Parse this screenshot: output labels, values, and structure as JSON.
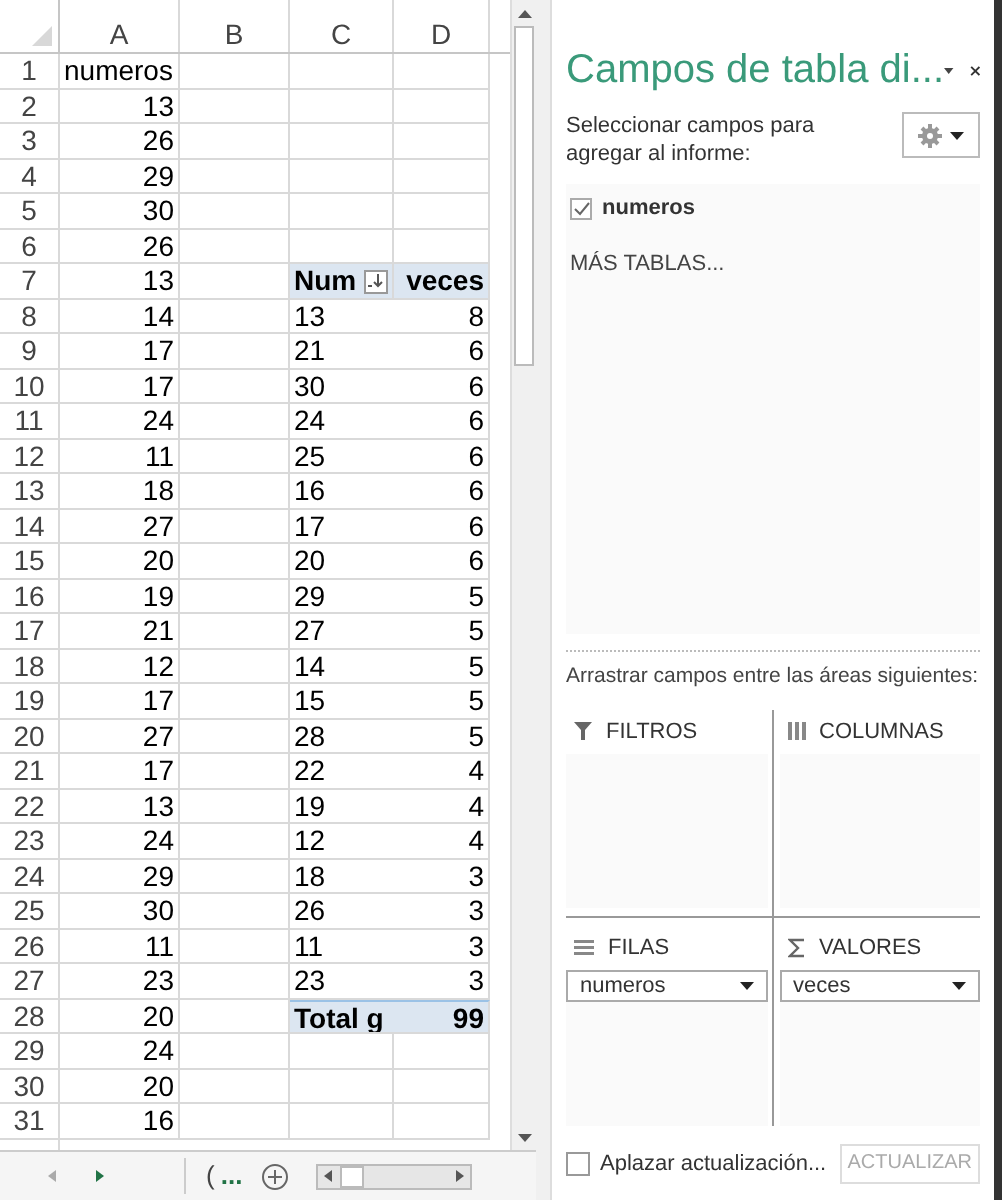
{
  "sheet": {
    "columns": [
      "A",
      "B",
      "C",
      "D"
    ],
    "row_numbers": [
      "1",
      "2",
      "3",
      "4",
      "5",
      "6",
      "7",
      "8",
      "9",
      "10",
      "11",
      "12",
      "13",
      "14",
      "15",
      "16",
      "17",
      "18",
      "19",
      "20",
      "21",
      "22",
      "23",
      "24",
      "25",
      "26",
      "27",
      "28",
      "29",
      "30",
      "31"
    ],
    "column_a": {
      "header": "numeros",
      "values": [
        "13",
        "26",
        "29",
        "30",
        "26",
        "13",
        "14",
        "17",
        "17",
        "24",
        "11",
        "18",
        "27",
        "20",
        "19",
        "21",
        "12",
        "17",
        "27",
        "17",
        "13",
        "24",
        "29",
        "30",
        "11",
        "23",
        "20",
        "24",
        "20",
        "16"
      ]
    },
    "pivot": {
      "header": [
        "Num",
        "veces"
      ],
      "rows": [
        [
          "13",
          "8"
        ],
        [
          "21",
          "6"
        ],
        [
          "30",
          "6"
        ],
        [
          "24",
          "6"
        ],
        [
          "25",
          "6"
        ],
        [
          "16",
          "6"
        ],
        [
          "17",
          "6"
        ],
        [
          "20",
          "6"
        ],
        [
          "29",
          "5"
        ],
        [
          "27",
          "5"
        ],
        [
          "14",
          "5"
        ],
        [
          "15",
          "5"
        ],
        [
          "28",
          "5"
        ],
        [
          "22",
          "4"
        ],
        [
          "19",
          "4"
        ],
        [
          "12",
          "4"
        ],
        [
          "18",
          "3"
        ],
        [
          "26",
          "3"
        ],
        [
          "11",
          "3"
        ],
        [
          "23",
          "3"
        ]
      ],
      "total": [
        "Total g",
        "99"
      ]
    }
  },
  "tab_bar": {
    "sheet_tab": "(",
    "more": "..."
  },
  "panel": {
    "title": "Campos de tabla di...",
    "subtitle": "Seleccionar campos para agregar al informe:",
    "fields": [
      {
        "label": "numeros",
        "checked": true
      }
    ],
    "more_tables": "MÁS TABLAS...",
    "drag_hint": "Arrastrar campos entre las áreas siguientes:",
    "areas": [
      {
        "kind": "filters",
        "label": "FILTROS"
      },
      {
        "kind": "columns",
        "label": "COLUMNAS"
      },
      {
        "kind": "rows",
        "label": "FILAS",
        "fields": [
          "numeros"
        ]
      },
      {
        "kind": "values",
        "label": "VALORES",
        "fields": [
          "veces"
        ]
      }
    ],
    "defer": {
      "label": "Aplazar actualización...",
      "checked": false
    },
    "update_button": {
      "label": "ACTUALIZAR",
      "disabled": true
    }
  }
}
